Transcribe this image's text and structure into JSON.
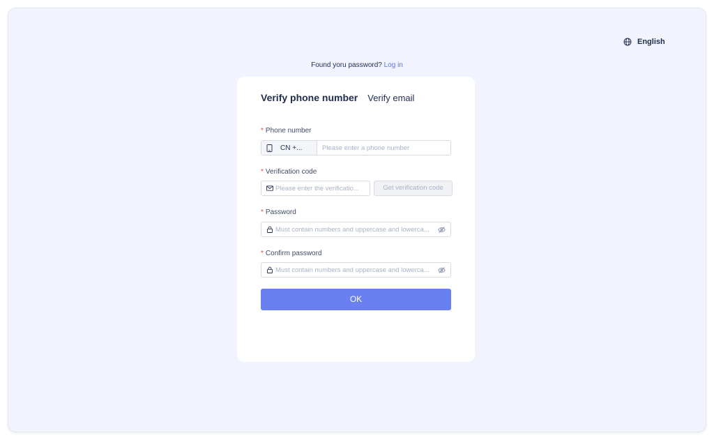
{
  "language": {
    "label": "English",
    "icon": "globe-icon"
  },
  "login_prompt": {
    "text": "Found yoru password?",
    "link": "Log in"
  },
  "tabs": [
    {
      "label": "Verify phone number",
      "active": true
    },
    {
      "label": "Verify email",
      "active": false
    }
  ],
  "form": {
    "phone": {
      "label": "Phone number",
      "required": "*",
      "country_code": "CN +...",
      "placeholder": "Please enter a phone number",
      "icon": "phone-icon"
    },
    "code": {
      "label": "Verification code",
      "required": "*",
      "placeholder": "Please enter the verificatio...",
      "button": "Get verification code",
      "icon": "mail-icon"
    },
    "password": {
      "label": "Password",
      "required": "*",
      "placeholder": "Must contain numbers and uppercase and lowerca...",
      "icon": "lock-icon"
    },
    "confirm": {
      "label": "Confirm password",
      "required": "*",
      "placeholder": "Must contain numbers and uppercase and lowerca...",
      "icon": "lock-icon"
    },
    "submit": "OK"
  },
  "colors": {
    "background": "#f1f4fe",
    "accent": "#6a7ff0",
    "link": "#5b73e8",
    "required": "#e5484d"
  }
}
